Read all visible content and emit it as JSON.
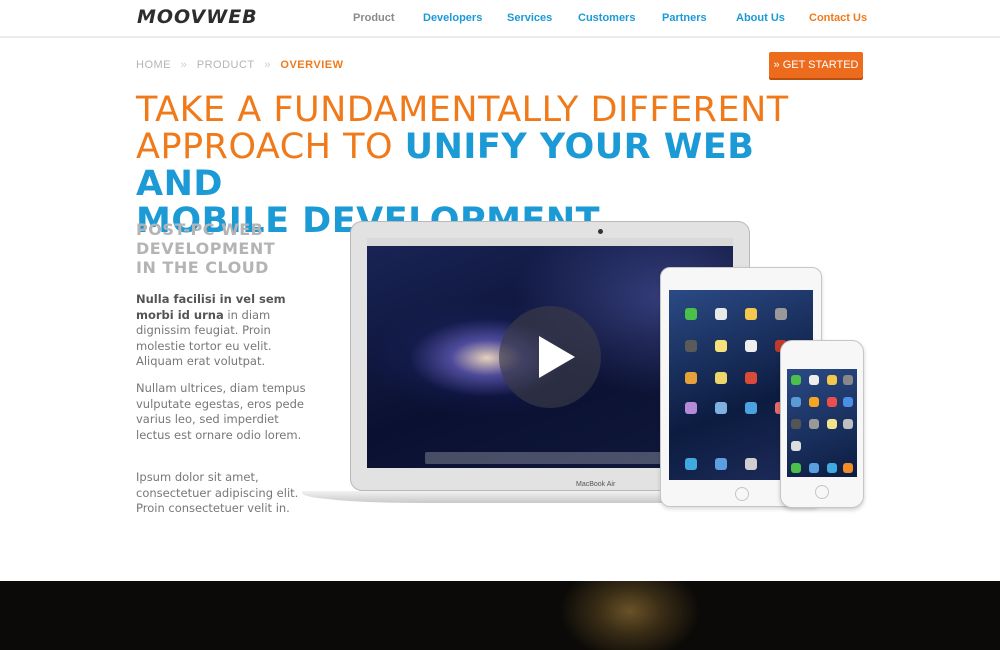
{
  "brand": {
    "logo_text": "MOOVWEB"
  },
  "nav": {
    "items": [
      {
        "label": "Product",
        "state": "active"
      },
      {
        "label": "Developers"
      },
      {
        "label": "Services"
      },
      {
        "label": "Customers"
      },
      {
        "label": "Partners"
      },
      {
        "label": "About Us"
      },
      {
        "label": "Contact Us",
        "state": "highlight"
      }
    ]
  },
  "breadcrumb": {
    "home": "HOME",
    "product": "PRODUCT",
    "current": "OVERVIEW",
    "separator": "»"
  },
  "cta": {
    "label": "» GET STARTED"
  },
  "headline": {
    "line1_orange": "TAKE A FUNDAMENTALLY DIFFERENT",
    "line2_orange": "APPROACH TO ",
    "line2_blue": "UNIFY YOUR WEB AND",
    "line3_blue": "MOBILE DEVELOPMENT."
  },
  "subhead": {
    "line1": "POST-PC WEB",
    "line2": "DEVELOPMENT",
    "line3": "IN THE CLOUD"
  },
  "body": {
    "p1_bold": "Nulla facilisi in vel sem morbi id urna",
    "p1_rest": " in diam dignissim feugiat. Proin molestie tortor eu velit. Aliquam erat volutpat.",
    "p2": "Nullam ultrices, diam tempus vulputate egestas, eros pede varius leo, sed imperdiet lectus est ornare odio lorem.",
    "p3": "Ipsum dolor sit amet, consectetuer adipiscing elit. Proin consectetuer velit in."
  },
  "devices": {
    "laptop_label": "MacBook Air"
  },
  "colors": {
    "orange": "#f07a1a",
    "blue": "#1c9ad6",
    "gray_text": "#b4b4b4",
    "cta": "#ec6b1c"
  }
}
